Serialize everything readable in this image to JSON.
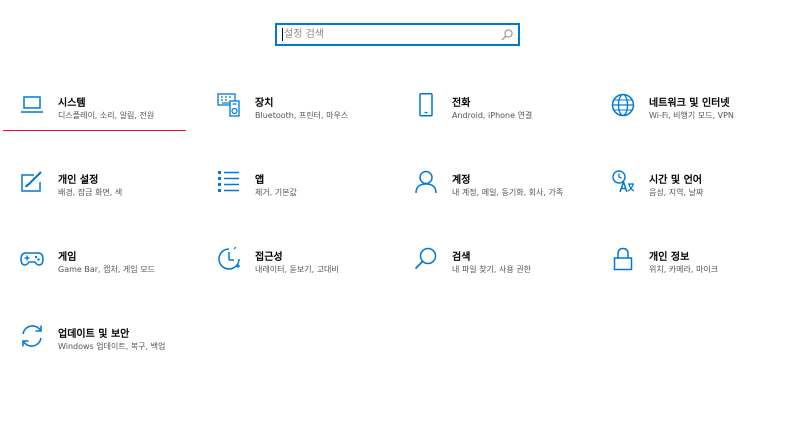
{
  "search": {
    "placeholder": "설정 검색"
  },
  "colors": {
    "accent": "#0078d7",
    "focus_underline": "#e81123"
  },
  "tiles": [
    {
      "icon": "laptop-icon",
      "title": "시스템",
      "desc": "디스플레이, 소리, 알림, 전원"
    },
    {
      "icon": "keyboard-devices-icon",
      "title": "장치",
      "desc": "Bluetooth, 프린터, 마우스"
    },
    {
      "icon": "phone-icon",
      "title": "전화",
      "desc": "Android, iPhone 연결"
    },
    {
      "icon": "globe-icon",
      "title": "네트워크 및 인터넷",
      "desc": "Wi-Fi, 비행기 모드, VPN"
    },
    {
      "icon": "paint-brush-icon",
      "title": "개인 설정",
      "desc": "배경, 잠금 화면, 색"
    },
    {
      "icon": "apps-list-icon",
      "title": "앱",
      "desc": "제거, 기본값"
    },
    {
      "icon": "person-icon",
      "title": "계정",
      "desc": "내 계정, 메일, 동기화, 회사, 가족"
    },
    {
      "icon": "language-icon",
      "title": "시간 및 언어",
      "desc": "음성, 지역, 날짜"
    },
    {
      "icon": "gamepad-icon",
      "title": "게임",
      "desc": "Game Bar, 캡처, 게임 모드"
    },
    {
      "icon": "accessibility-icon",
      "title": "접근성",
      "desc": "내레이터, 돋보기, 고대비"
    },
    {
      "icon": "search-icon",
      "title": "검색",
      "desc": "내 파일 찾기, 사용 권한"
    },
    {
      "icon": "lock-icon",
      "title": "개인 정보",
      "desc": "위치, 카메라, 마이크"
    },
    {
      "icon": "update-sync-icon",
      "title": "업데이트 및 보안",
      "desc": "Windows 업데이트, 복구, 백업"
    }
  ]
}
